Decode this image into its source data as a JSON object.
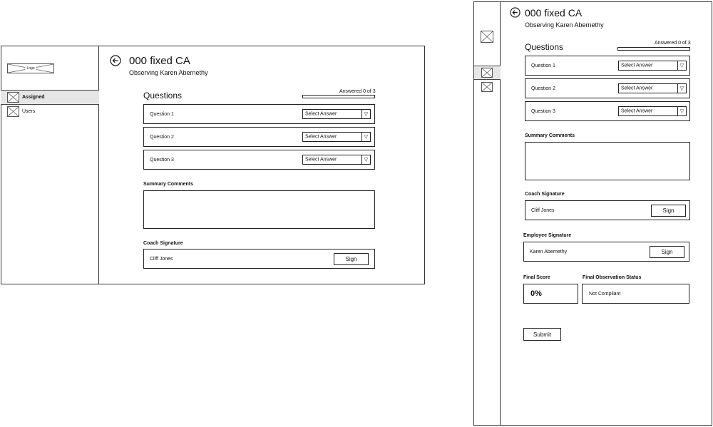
{
  "desktop": {
    "sidebar": {
      "logo_text": "Logo",
      "items": [
        {
          "label": "Assigned",
          "selected": true
        },
        {
          "label": "Users",
          "selected": false
        }
      ]
    },
    "title": "000 fixed CA",
    "subtitle": "Observing Karen Abernethy",
    "questions_heading": "Questions",
    "answered_text": "Answered 0 of 3",
    "answered_progress": 0,
    "questions": [
      {
        "label": "Question 1",
        "placeholder": "Select Answer"
      },
      {
        "label": "Question 2",
        "placeholder": "Select Answer"
      },
      {
        "label": "Question 3",
        "placeholder": "Select Answer"
      }
    ],
    "summary_label": "Summary Comments",
    "coach_signature_label": "Coach Signature",
    "coach_name": "Cliff Jones",
    "sign_label": "Sign"
  },
  "mobile": {
    "title": "000 fixed CA",
    "subtitle": "Observing Karen Abernethy",
    "questions_heading": "Questions",
    "answered_text": "Answered 0 of 3",
    "answered_progress": 0,
    "questions": [
      {
        "label": "Question 1",
        "placeholder": "Select Answer"
      },
      {
        "label": "Question 2",
        "placeholder": "Select Answer"
      },
      {
        "label": "Question 3",
        "placeholder": "Select Answer"
      }
    ],
    "summary_label": "Summary Comments",
    "coach_signature_label": "Coach Signature",
    "coach_name": "Cliff Jones",
    "employee_signature_label": "Employee Signature",
    "employee_name": "Karen Abernethy",
    "sign_label": "Sign",
    "final_score_label": "Final Score",
    "final_score_value": "0%",
    "final_status_label": "Final Observation Status",
    "final_status_value": "Not Compliant",
    "submit_label": "Submit"
  }
}
